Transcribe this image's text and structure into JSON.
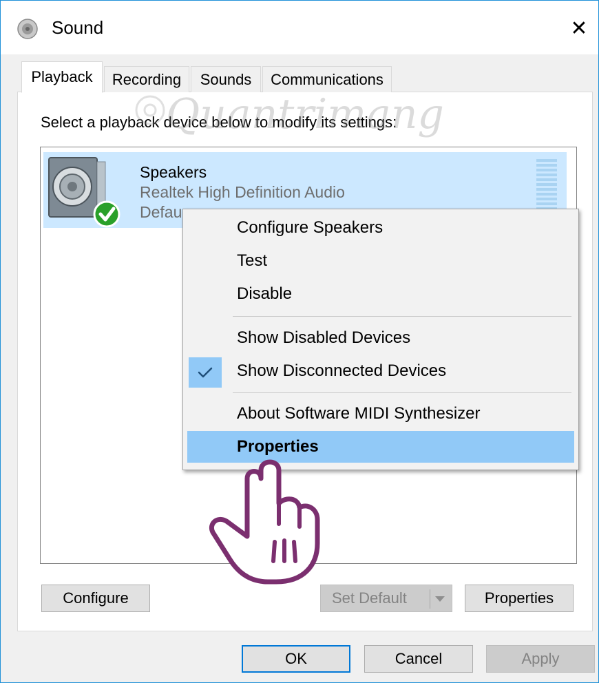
{
  "window": {
    "title": "Sound",
    "close_glyph": "✕"
  },
  "tabs": [
    {
      "label": "Playback",
      "active": true
    },
    {
      "label": "Recording",
      "active": false
    },
    {
      "label": "Sounds",
      "active": false
    },
    {
      "label": "Communications",
      "active": false
    }
  ],
  "instruction": "Select a playback device below to modify its settings:",
  "watermark": "Quantrimang",
  "device": {
    "name": "Speakers",
    "driver": "Realtek High Definition Audio",
    "status": "Default Device",
    "status_visible": "Defau",
    "icon": "speaker-icon",
    "status_icon": "green-check-icon"
  },
  "context_menu": {
    "items": [
      {
        "label": "Configure Speakers"
      },
      {
        "label": "Test"
      },
      {
        "label": "Disable"
      },
      {
        "label": "Show Disabled Devices",
        "checked": false
      },
      {
        "label": "Show Disconnected Devices",
        "checked": true
      },
      {
        "label": "About Software MIDI Synthesizer"
      },
      {
        "label": "Properties",
        "highlighted": true,
        "bold": true
      }
    ]
  },
  "buttons": {
    "configure": "Configure",
    "set_default": "Set Default",
    "properties": "Properties",
    "ok": "OK",
    "cancel": "Cancel",
    "apply": "Apply"
  },
  "colors": {
    "selection": "#cce8ff",
    "menu_highlight": "#91c9f7",
    "accent": "#0078d7",
    "hand_outline": "#7b2f6f"
  }
}
